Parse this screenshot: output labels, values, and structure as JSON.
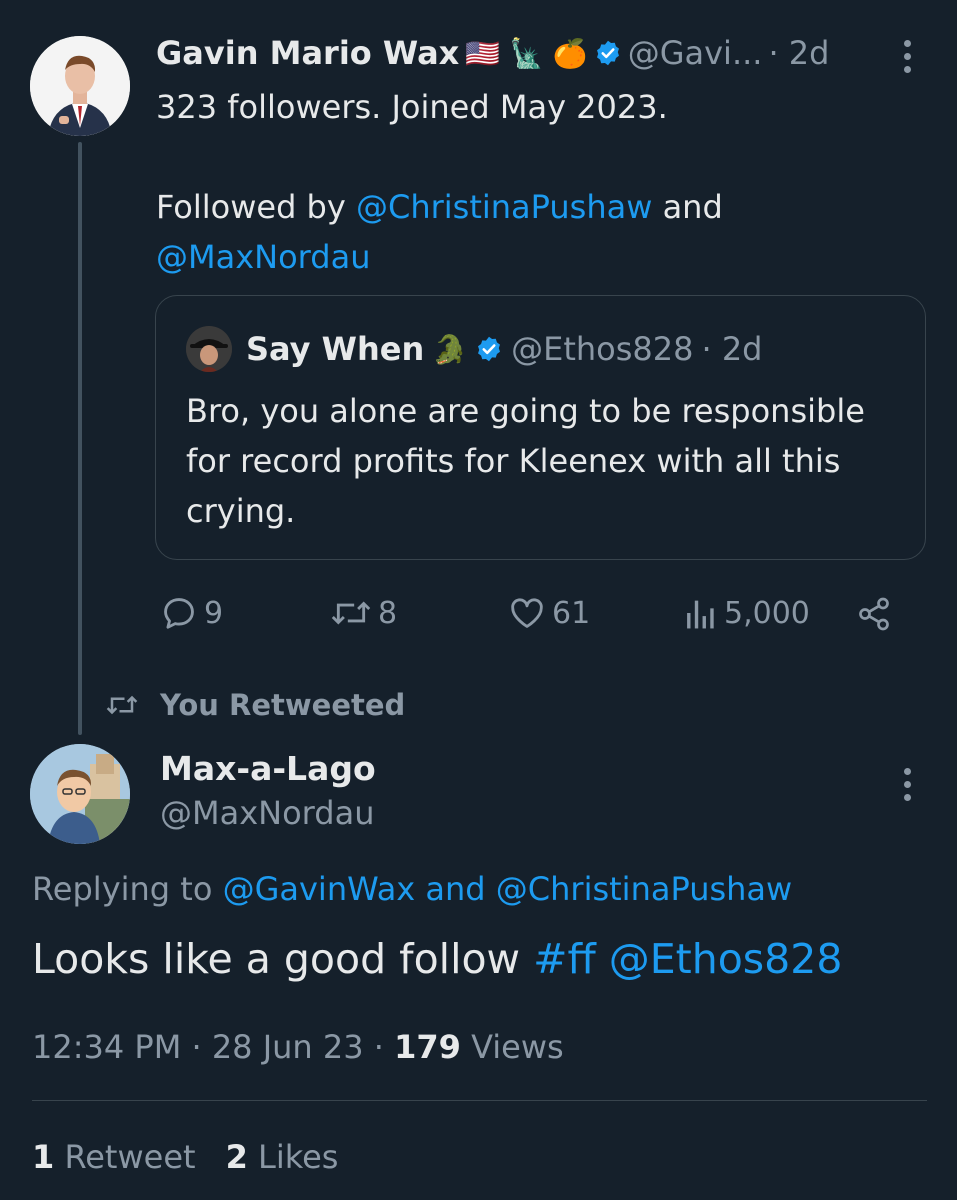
{
  "tweet1": {
    "name": "Gavin Mario Wax",
    "flags": "🇺🇸 🗽 🍊",
    "handle": "@Gavi...",
    "time": "· 2d",
    "line1": "323 followers. Joined May 2023.",
    "followed_prefix": "Followed by ",
    "followed_user1": "@ChristinaPushaw",
    "followed_and": " and",
    "followed_user2": "@MaxNordau",
    "stats": {
      "replies": "9",
      "retweets": "8",
      "likes": "61",
      "views": "5,000"
    }
  },
  "quote": {
    "name": "Say When",
    "emoji": "🐊",
    "handle": "@Ethos828",
    "time": "· 2d",
    "text": "Bro, you alone are going to be responsible for record profits for Kleenex with all this crying."
  },
  "retweet_label": "You Retweeted",
  "tweet2": {
    "name": "Max-a-Lago",
    "handle": "@MaxNordau",
    "replying_prefix": "Replying to ",
    "replying_users": "@GavinWax and @ChristinaPushaw",
    "text_plain": "Looks like a good follow ",
    "text_links": "#ff @Ethos828",
    "time": "12:34 PM · 28 Jun 23 · ",
    "views_count": "179",
    "views_label": " Views",
    "retweets_count": "1",
    "retweets_label": " Retweet",
    "likes_count": "2",
    "likes_label": " Likes"
  },
  "colors": {
    "background": "#15202b",
    "link": "#1d9bf0",
    "muted": "#8b98a5",
    "text": "#e7e9ea"
  }
}
